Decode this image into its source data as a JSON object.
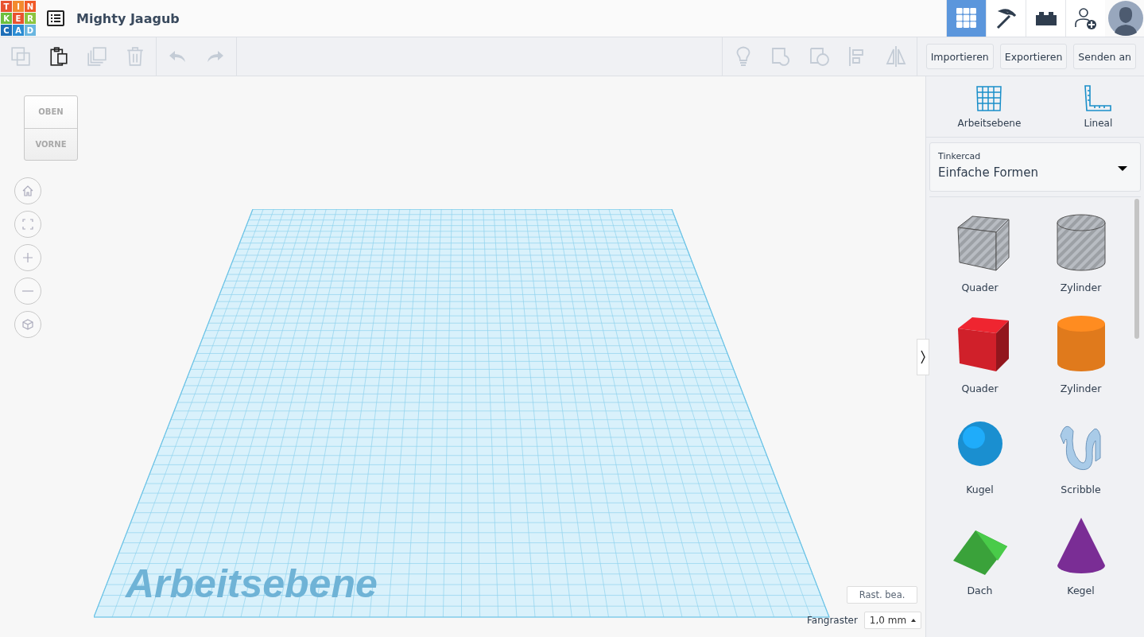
{
  "logo": [
    {
      "letter": "T",
      "color": "#e8532f"
    },
    {
      "letter": "I",
      "color": "#f38a2e"
    },
    {
      "letter": "N",
      "color": "#f05a28"
    },
    {
      "letter": "K",
      "color": "#6cbf3e"
    },
    {
      "letter": "E",
      "color": "#e8532f"
    },
    {
      "letter": "R",
      "color": "#8dc43f"
    },
    {
      "letter": "C",
      "color": "#1e6fb8"
    },
    {
      "letter": "A",
      "color": "#2b8cd3"
    },
    {
      "letter": "D",
      "color": "#6ab6e0"
    }
  ],
  "project_title": "Mighty Jaagub",
  "nav": [
    {
      "kind": "grid",
      "selected": true
    },
    {
      "kind": "pickaxe",
      "selected": false
    },
    {
      "kind": "brick",
      "selected": false
    },
    {
      "kind": "add-user",
      "selected": false
    }
  ],
  "toolbar": [
    {
      "kind": "copy",
      "disabled": true
    },
    {
      "kind": "paste",
      "disabled": false
    },
    {
      "kind": "duplicate",
      "disabled": true
    },
    {
      "kind": "delete",
      "disabled": true
    },
    {
      "kind": "undo",
      "disabled": true
    },
    {
      "kind": "redo",
      "disabled": true
    }
  ],
  "toolbar_right": [
    {
      "kind": "bulb",
      "disabled": true
    },
    {
      "kind": "group",
      "disabled": true
    },
    {
      "kind": "ungroup",
      "disabled": true
    },
    {
      "kind": "align",
      "disabled": true
    },
    {
      "kind": "mirror",
      "disabled": true
    }
  ],
  "actions": [
    "Importieren",
    "Exportieren",
    "Senden an"
  ],
  "view_cube": {
    "top": "OBEN",
    "front": "VORNE"
  },
  "view_controls": [
    {
      "kind": "home"
    },
    {
      "kind": "fit"
    },
    {
      "kind": "zoom-in"
    },
    {
      "kind": "zoom-out"
    },
    {
      "kind": "perspective"
    }
  ],
  "workplane_label": "Arbeitsebene",
  "edit_grid": "Rast. bea.",
  "snap_grid": {
    "label": "Fangraster",
    "value": "1,0 mm"
  },
  "panel_tools": [
    {
      "kind": "workplane",
      "label": "Arbeitsebene"
    },
    {
      "kind": "ruler",
      "label": "Lineal"
    }
  ],
  "library": {
    "label": "Tinkercad",
    "value": "Einfache Formen"
  },
  "shapes": [
    {
      "kind": "box-hole",
      "label": "Quader",
      "color": "#b8bcc2"
    },
    {
      "kind": "cylinder-hole",
      "label": "Zylinder",
      "color": "#b8bcc2"
    },
    {
      "kind": "box",
      "label": "Quader",
      "color": "#d0202a"
    },
    {
      "kind": "cylinder",
      "label": "Zylinder",
      "color": "#e07a1c"
    },
    {
      "kind": "sphere",
      "label": "Kugel",
      "color": "#1a8fd0"
    },
    {
      "kind": "scribble",
      "label": "Scribble",
      "color": "#a9cbe8"
    },
    {
      "kind": "roof",
      "label": "Dach",
      "color": "#3aa23a"
    },
    {
      "kind": "cone",
      "label": "Kegel",
      "color": "#7a2d95"
    }
  ]
}
